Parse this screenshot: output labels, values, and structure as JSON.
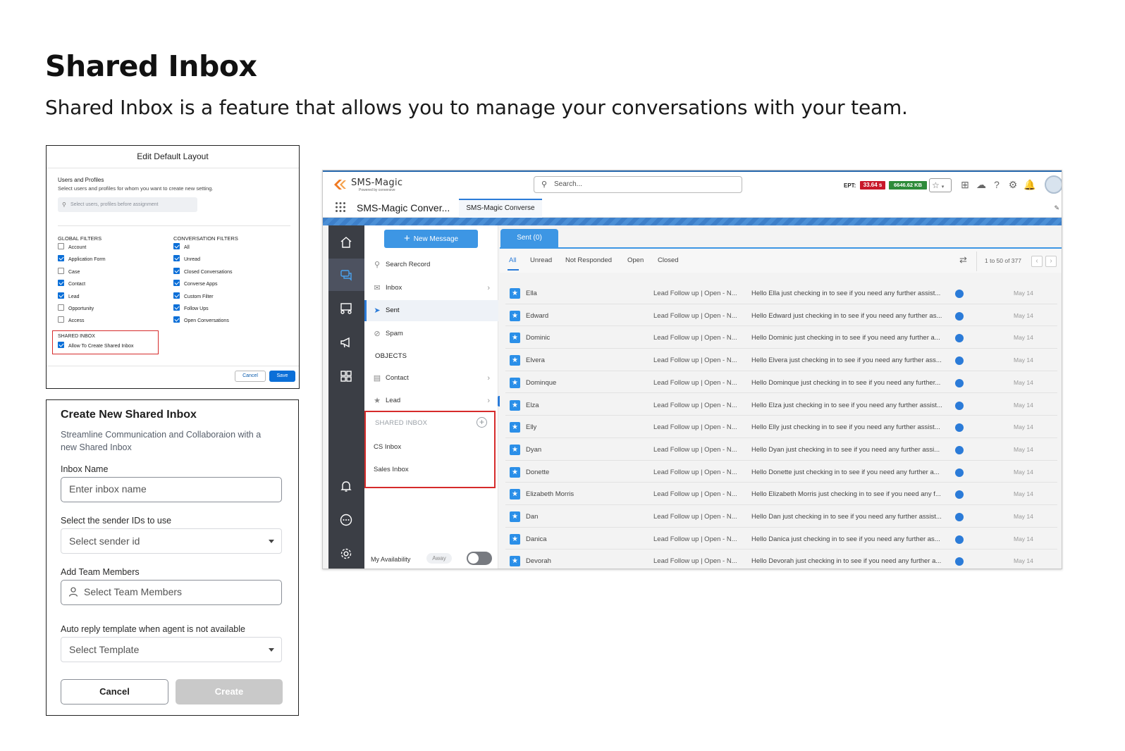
{
  "page": {
    "title": "Shared Inbox",
    "subtitle": "Shared Inbox is a feature that allows you to manage your conversations with your team."
  },
  "edit_layout": {
    "title": "Edit Default Layout",
    "users_profiles_title": "Users and Profiles",
    "users_profiles_desc": "Select users and profiles for whom you want to create new setting.",
    "search_placeholder": "Select users, profiles before assignment",
    "global_filters_title": "GLOBAL FILTERS",
    "global_filters": [
      {
        "label": "Account",
        "checked": false
      },
      {
        "label": "Application Form",
        "checked": true
      },
      {
        "label": "Case",
        "checked": false
      },
      {
        "label": "Contact",
        "checked": true
      },
      {
        "label": "Lead",
        "checked": true
      },
      {
        "label": "Opportunity",
        "checked": false
      },
      {
        "label": "Access",
        "checked": false
      }
    ],
    "conversation_filters_title": "CONVERSATION FILTERS",
    "conversation_filters": [
      {
        "label": "All",
        "checked": true
      },
      {
        "label": "Unread",
        "checked": true
      },
      {
        "label": "Closed Conversations",
        "checked": true
      },
      {
        "label": "Converse Apps",
        "checked": true
      },
      {
        "label": "Custom Filter",
        "checked": true
      },
      {
        "label": "Follow Ups",
        "checked": true
      },
      {
        "label": "Open Conversations",
        "checked": true
      }
    ],
    "shared_inbox_title": "SHARED INBOX",
    "shared_inbox_option": "Allow To Create Shared Inbox",
    "shared_inbox_checked": true,
    "cancel_label": "Cancel",
    "save_label": "Save"
  },
  "create_inbox": {
    "title": "Create New Shared Inbox",
    "description": "Streamline Communication and Collaboraion with a new Shared Inbox",
    "inbox_name_label": "Inbox Name",
    "inbox_name_placeholder": "Enter inbox name",
    "sender_label": "Select the sender IDs to use",
    "sender_placeholder": "Select sender id",
    "team_label": "Add Team Members",
    "team_placeholder": "Select Team Members",
    "template_label": "Auto reply template when agent is not available",
    "template_placeholder": "Select Template",
    "cancel_label": "Cancel",
    "create_label": "Create"
  },
  "app": {
    "logo_text": "SMS-Magic",
    "logo_sub": "Powered by conversive",
    "search_placeholder": "Search...",
    "ept_label": "EPT:",
    "ept_time": "33.64 s",
    "ept_size": "6646.62 KB",
    "app_name": "SMS-Magic Conver...",
    "app_tab": "SMS-Magic Converse",
    "new_message_label": "New Message",
    "nav": {
      "search_record": "Search Record",
      "inbox": "Inbox",
      "sent": "Sent",
      "spam": "Spam",
      "objects_head": "OBJECTS",
      "contact": "Contact",
      "lead": "Lead",
      "shared_inbox_head": "SHARED INBOX",
      "shared_inboxes": [
        "CS Inbox",
        "Sales Inbox"
      ],
      "availability_label": "My Availability",
      "availability_status": "Away"
    },
    "content_tab": "Sent (0)",
    "filter_tabs": [
      "All",
      "Unread",
      "Not Responded",
      "Open",
      "Closed"
    ],
    "active_filter": "All",
    "pager_text": "1 to 50 of 377",
    "rows": [
      {
        "name": "Ella",
        "topic": "Lead Follow up | Open - N...",
        "message": "Hello Ella just checking in to see if you need any further assist...",
        "date": "May 14"
      },
      {
        "name": "Edward",
        "topic": "Lead Follow up | Open - N...",
        "message": "Hello Edward just checking in to see if you need any further as...",
        "date": "May 14"
      },
      {
        "name": "Dominic",
        "topic": "Lead Follow up | Open - N...",
        "message": "Hello Dominic just checking in to see if you need any further a...",
        "date": "May 14"
      },
      {
        "name": "Elvera",
        "topic": "Lead Follow up | Open - N...",
        "message": "Hello Elvera just checking in to see if you need any further ass...",
        "date": "May 14"
      },
      {
        "name": "Dominque",
        "topic": "Lead Follow up | Open - N...",
        "message": "Hello Dominque just checking in to see if you need any further...",
        "date": "May 14"
      },
      {
        "name": "Elza",
        "topic": "Lead Follow up | Open - N...",
        "message": "Hello Elza just checking in to see if you need any further assist...",
        "date": "May 14"
      },
      {
        "name": "Elly",
        "topic": "Lead Follow up | Open - N...",
        "message": "Hello Elly just checking in to see if you need any further assist...",
        "date": "May 14"
      },
      {
        "name": "Dyan",
        "topic": "Lead Follow up | Open - N...",
        "message": "Hello Dyan just checking in to see if you need any further assi...",
        "date": "May 14"
      },
      {
        "name": "Donette",
        "topic": "Lead Follow up | Open - N...",
        "message": "Hello Donette just checking in to see if you need any further a...",
        "date": "May 14"
      },
      {
        "name": "Elizabeth Morris",
        "topic": "Lead Follow up | Open - N...",
        "message": "Hello Elizabeth Morris just checking in to see if you need any f...",
        "date": "May 14"
      },
      {
        "name": "Dan",
        "topic": "Lead Follow up | Open - N...",
        "message": "Hello Dan just checking in to see if you need any further assist...",
        "date": "May 14"
      },
      {
        "name": "Danica",
        "topic": "Lead Follow up | Open - N...",
        "message": "Hello Danica just checking in to see if you need any further as...",
        "date": "May 14"
      },
      {
        "name": "Devorah",
        "topic": "Lead Follow up | Open - N...",
        "message": "Hello Devorah just checking in to see if you need any further a...",
        "date": "May 14"
      }
    ]
  },
  "colors": {
    "accent_blue": "#3d96e4",
    "highlight_red": "#d62b2b",
    "ept_red": "#c8192a",
    "ept_green": "#2e8b3a",
    "rail_dark": "#3b3e45"
  }
}
